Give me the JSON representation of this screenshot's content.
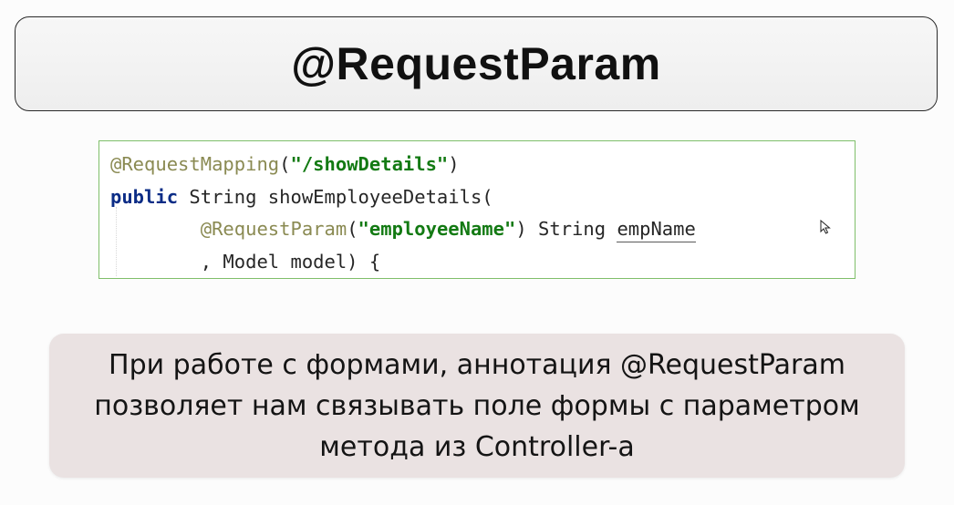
{
  "title": "@RequestParam",
  "code": {
    "line1": {
      "annotation": "@RequestMapping",
      "open": "(",
      "string": "\"/showDetails\"",
      "close": ")"
    },
    "line2": {
      "keyword": "public",
      "rest": " String showEmployeeDetails("
    },
    "line3": {
      "indent": "        ",
      "annotation": "@RequestParam",
      "open": "(",
      "string": "\"employeeName\"",
      "close": ") String ",
      "param": "empName"
    },
    "line4": {
      "text": "        , Model model) {"
    }
  },
  "cursor_icon": "mouse-pointer-icon",
  "note": {
    "lines": [
      "При работе с формами, аннотация @RequestParam",
      "позволяет нам связывать поле формы с параметром",
      "метода из Controller-a"
    ]
  },
  "colors": {
    "annotation": "#8a8a52",
    "keyword": "#0b2c86",
    "string": "#137a13",
    "code_border": "#7fbf6a",
    "note_background": "#eae2e2"
  }
}
